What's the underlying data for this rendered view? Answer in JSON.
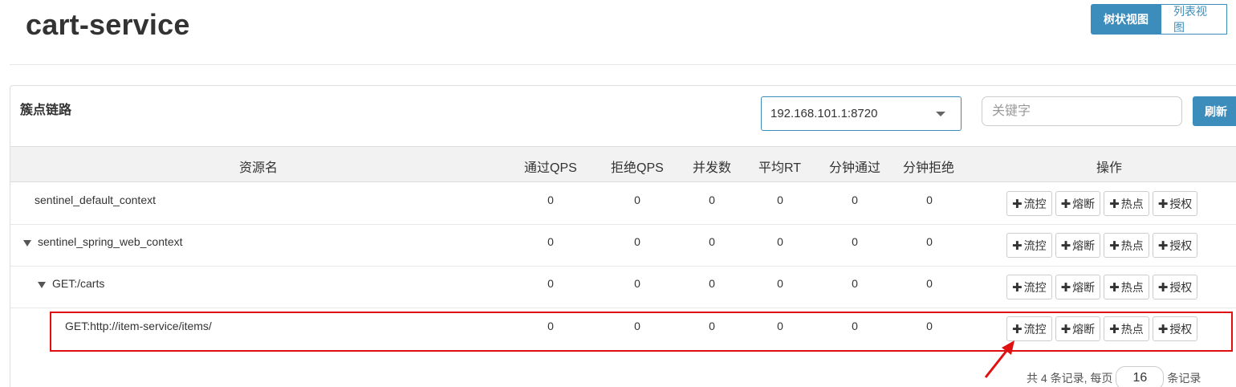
{
  "page": {
    "title": "cart-service",
    "view_toggle": {
      "tree_label": "树状视图",
      "list_label": "列表视图"
    }
  },
  "panel": {
    "title": "簇点链路",
    "machine_select": {
      "value": "192.168.101.1:8720"
    },
    "keyword": {
      "placeholder": "关键字",
      "value": ""
    },
    "refresh_label": "刷新"
  },
  "table": {
    "headers": {
      "resource": "资源名",
      "pass_qps": "通过QPS",
      "block_qps": "拒绝QPS",
      "threads": "并发数",
      "avg_rt": "平均RT",
      "min_pass": "分钟通过",
      "min_block": "分钟拒绝",
      "ops": "操作"
    },
    "actions": {
      "flow": "流控",
      "degrade": "熔断",
      "hot": "热点",
      "auth": "授权"
    },
    "rows": [
      {
        "name": "sentinel_default_context",
        "pass_qps": "0",
        "block_qps": "0",
        "threads": "0",
        "avg_rt": "0",
        "min_pass": "0",
        "min_block": "0"
      },
      {
        "name": "sentinel_spring_web_context",
        "pass_qps": "0",
        "block_qps": "0",
        "threads": "0",
        "avg_rt": "0",
        "min_pass": "0",
        "min_block": "0"
      },
      {
        "name": "GET:/carts",
        "pass_qps": "0",
        "block_qps": "0",
        "threads": "0",
        "avg_rt": "0",
        "min_pass": "0",
        "min_block": "0"
      },
      {
        "name": "GET:http://item-service/items/",
        "pass_qps": "0",
        "block_qps": "0",
        "threads": "0",
        "avg_rt": "0",
        "min_pass": "0",
        "min_block": "0"
      }
    ]
  },
  "pagination": {
    "prefix": "共 4 条记录, 每页",
    "page_size": "16",
    "suffix": "条记录"
  },
  "colors": {
    "primary": "#3c8dbc",
    "highlight": "#e01010"
  }
}
